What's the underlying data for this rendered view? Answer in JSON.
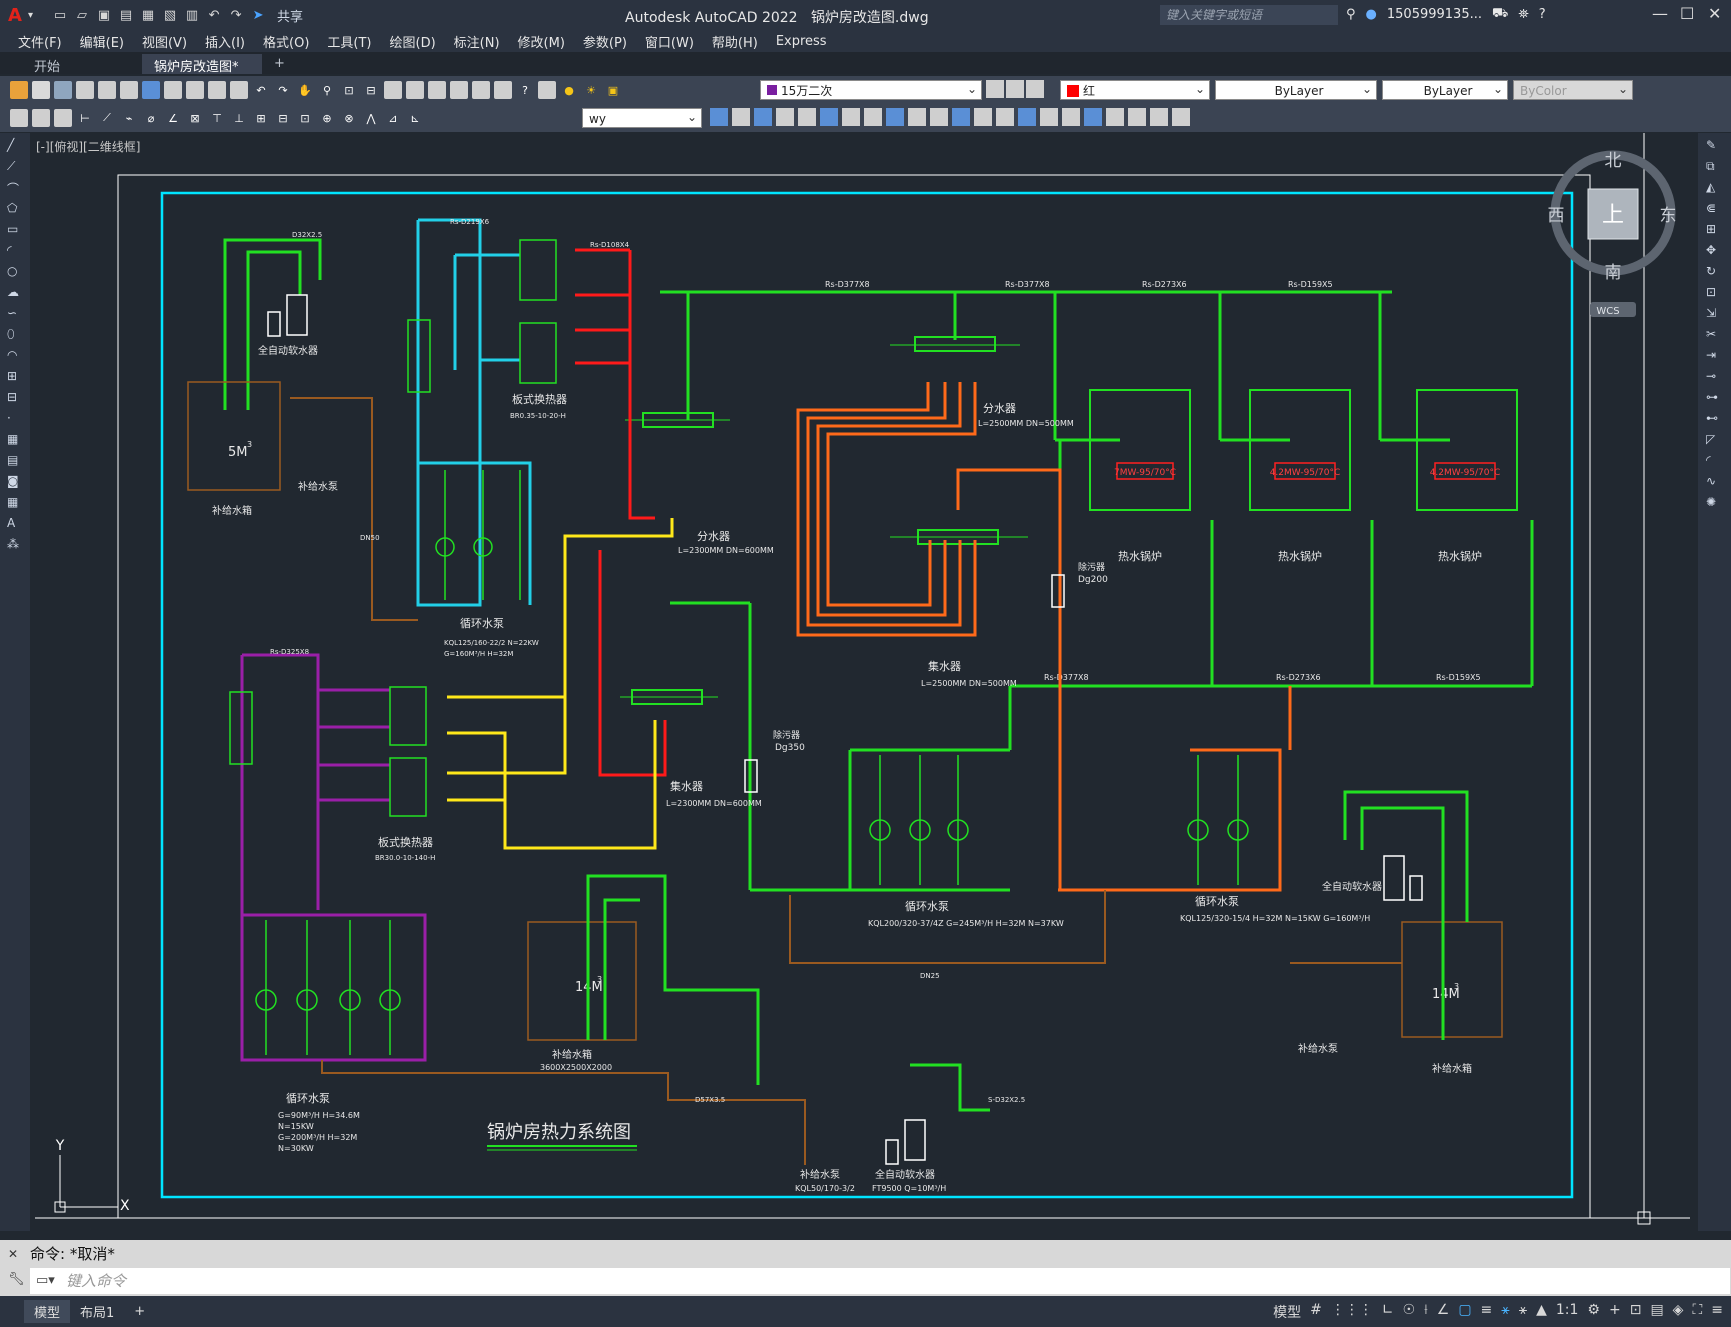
{
  "app": {
    "title": "Autodesk AutoCAD 2022",
    "filename": "锅炉房改造图.dwg",
    "share_label": "共享",
    "search_placeholder": "键入关键字或短语",
    "user": "1505999135...",
    "logo": "A"
  },
  "menu": [
    "文件(F)",
    "编辑(E)",
    "视图(V)",
    "插入(I)",
    "格式(O)",
    "工具(T)",
    "绘图(D)",
    "标注(N)",
    "修改(M)",
    "参数(P)",
    "窗口(W)",
    "帮助(H)",
    "Express"
  ],
  "tabs": {
    "start": "开始",
    "doc": "锅炉房改造图*",
    "add": "+"
  },
  "props": {
    "layer": "15万二次",
    "color": "红",
    "linetype": "ByLayer",
    "lineweight": "ByLayer",
    "plotstyle": "ByColor",
    "textstyle": "wy"
  },
  "viewport": {
    "label": "[-][俯视][二维线框]"
  },
  "viewcube": {
    "north": "北",
    "south": "南",
    "east": "东",
    "west": "西",
    "top": "上",
    "wcs": "WCS"
  },
  "drawing": {
    "title": "锅炉房热力系统图",
    "labels": {
      "softener_tl": "全自动软水器",
      "tank5": "5M",
      "tank5_sup": "3",
      "makeup_tank_tl": "补给水箱",
      "makeup_pump_tl": "补给水泵",
      "plate_hex_top": "板式换热器",
      "plate_hex_top_model": "BR0.35-10-20-H",
      "circ_pump_top": "循环水泵",
      "circ_pump_top_spec1": "KQL125/160-22/2 N=22KW",
      "circ_pump_top_spec2": "G=160M³/H  H=32M",
      "dist_header_1": "分水器",
      "dist_header_1_spec": "L=2300MM  DN=600MM",
      "dist_header_2": "分水器",
      "dist_header_2_spec": "L=2500MM  DN=500MM",
      "coll_header_1": "集水器",
      "coll_header_1_spec": "L=2500MM  DN=500MM",
      "coll_header_2": "集水器",
      "coll_header_2_spec": "L=2300MM  DN=600MM",
      "boiler_1": "热水锅炉",
      "boiler_2": "热水锅炉",
      "boiler_3": "热水锅炉",
      "boiler_1_tag": "7MW-95/70°C",
      "boiler_2_tag": "4.2MW-95/70°C",
      "boiler_3_tag": "4.2MW-95/70°C",
      "dirt_sep": "除污器",
      "dirt_sep_1": "Dg200",
      "dirt_sep_2": "Dg350",
      "plate_hex_mid": "板式换热器",
      "plate_hex_mid_model": "BR30.0-10-140-H",
      "circ_pump_mid": "循环水泵",
      "circ_pump_mid_spec": "KQL200/320-37/4Z  G=245M³/H  H=32M  N=37KW",
      "circ_pump_r": "循环水泵",
      "circ_pump_r_spec": "KQL125/320-15/4  H=32M  N=15KW  G=160M³/H",
      "circ_pump_bl": "循环水泵",
      "circ_pump_bl_spec1": "G=90M³/H  H=34.6M",
      "circ_pump_bl_spec2": "N=15KW",
      "circ_pump_bl_spec3": "G=200M³/H  H=32M",
      "circ_pump_bl_spec4": "N=30KW",
      "tank14_l": "14M",
      "tank14_r": "14M",
      "tank_sup": "3",
      "makeup_tank_b": "补给水箱",
      "makeup_tank_b_size": "3600X2500X2000",
      "makeup_pump_b": "补给水泵",
      "makeup_pump_b_spec": "KQL50/170-3/2",
      "softener_b": "全自动软水器",
      "softener_b_spec": "FT9500 Q=10M³/H",
      "softener_r": "全自动软水器",
      "makeup_pump_r": "补给水泵",
      "makeup_tank_r": "补给水箱",
      "pipe_main": "Rs-D377X8",
      "pipe_2": "Rs-D273X6",
      "pipe_3": "Rs-D159X5",
      "pipe_4": "Rs-D219X6",
      "pipe_5": "Rs-D325X8",
      "pipe_6": "Rs-D108X4",
      "pipe_7": "DN25",
      "pipe_8": "D57X3.5",
      "pipe_9": "D32X2.5",
      "pipe_10": "S-D32X2.5",
      "pipe_11": "DN50"
    }
  },
  "command": {
    "history": "命令: *取消*",
    "prompt": "键入命令"
  },
  "status": {
    "model": "模型",
    "layout": "布局1",
    "add": "+",
    "scale": "1:1",
    "model_btn": "模型"
  }
}
